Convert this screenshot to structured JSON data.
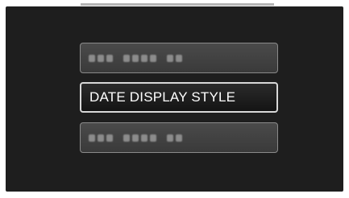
{
  "menu": {
    "items": [
      {
        "label": "",
        "state": "dimmed-blurred"
      },
      {
        "label": "DATE DISPLAY STYLE",
        "state": "selected"
      },
      {
        "label": "",
        "state": "dimmed-blurred"
      }
    ]
  },
  "colors": {
    "screen_bg": "#1e1e1e",
    "dim_item_bg": "#444444",
    "selected_border": "#d8d8d8",
    "text": "#ffffff"
  }
}
